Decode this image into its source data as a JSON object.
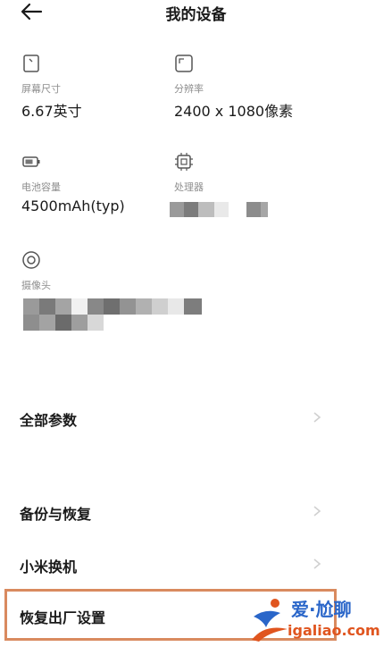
{
  "header": {
    "title": "我的设备",
    "back_icon": "arrow-left-icon"
  },
  "specs": {
    "screen": {
      "label": "屏幕尺寸",
      "value": "6.67英寸",
      "icon": "phone-icon"
    },
    "resolution": {
      "label": "分辨率",
      "value": "2400 x 1080像素",
      "icon": "resolution-icon"
    },
    "battery": {
      "label": "电池容量",
      "value": "4500mAh(typ)",
      "icon": "battery-icon"
    },
    "processor": {
      "label": "处理器",
      "icon": "chip-icon"
    },
    "camera": {
      "label": "摄像头",
      "icon": "camera-icon"
    }
  },
  "menu": {
    "all_params": "全部参数",
    "backup": "备份与恢复",
    "mi_mover": "小米换机",
    "factory_reset": "恢复出厂设置"
  },
  "watermark": {
    "title": "爱·尬聊",
    "url": "igaliao.com"
  },
  "colors": {
    "highlight_border": "#d98a5f",
    "watermark_blue": "#2a66c9",
    "watermark_orange": "#e0551f"
  }
}
